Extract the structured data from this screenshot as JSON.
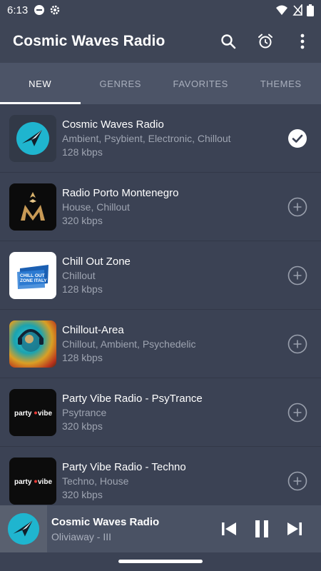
{
  "status": {
    "time": "6:13",
    "left_icons": [
      "do-not-disturb-icon",
      "settings-gear-icon"
    ],
    "right_icons": [
      "wifi-icon",
      "no-sim-icon",
      "battery-icon"
    ]
  },
  "appbar": {
    "title": "Cosmic Waves Radio",
    "actions": [
      "search-icon",
      "alarm-icon",
      "more-vert-icon"
    ]
  },
  "tabs": [
    {
      "label": "NEW",
      "active": true
    },
    {
      "label": "GENRES",
      "active": false
    },
    {
      "label": "FAVORITES",
      "active": false
    },
    {
      "label": "THEMES",
      "active": false
    }
  ],
  "stations": [
    {
      "name": "Cosmic Waves Radio",
      "genres": "Ambient, Psybient, Electronic, Chillout",
      "bitrate": "128 kbps",
      "selected": true,
      "logo": "cosmic-waves-logo"
    },
    {
      "name": "Radio Porto Montenegro",
      "genres": "House, Chillout",
      "bitrate": "320 kbps",
      "selected": false,
      "logo": "porto-montenegro-logo"
    },
    {
      "name": "Chill Out Zone",
      "genres": "Chillout",
      "bitrate": "128 kbps",
      "selected": false,
      "logo": "chill-out-zone-logo",
      "logo_text": "CHILL OUT ZONE ITALY"
    },
    {
      "name": "Chillout-Area",
      "genres": "Chillout, Ambient, Psychedelic",
      "bitrate": "128 kbps",
      "selected": false,
      "logo": "chillout-area-logo"
    },
    {
      "name": "Party Vibe Radio - PsyTrance",
      "genres": "Psytrance",
      "bitrate": "320 kbps",
      "selected": false,
      "logo": "party-vibe-logo",
      "logo_text": "party vibe"
    },
    {
      "name": "Party Vibe Radio - Techno",
      "genres": "Techno, House",
      "bitrate": "320 kbps",
      "selected": false,
      "logo": "party-vibe-logo",
      "logo_text": "party vibe"
    }
  ],
  "player": {
    "title": "Cosmic Waves Radio",
    "subtitle": "Oliviaway - III",
    "controls": [
      "skip-previous-icon",
      "pause-icon",
      "skip-next-icon"
    ]
  },
  "colors": {
    "appbar": "#3e4556",
    "background": "#3b4254",
    "tabbar": "#4c5467",
    "player": "#4a5264",
    "accent_cyan": "#1fb5cf"
  }
}
